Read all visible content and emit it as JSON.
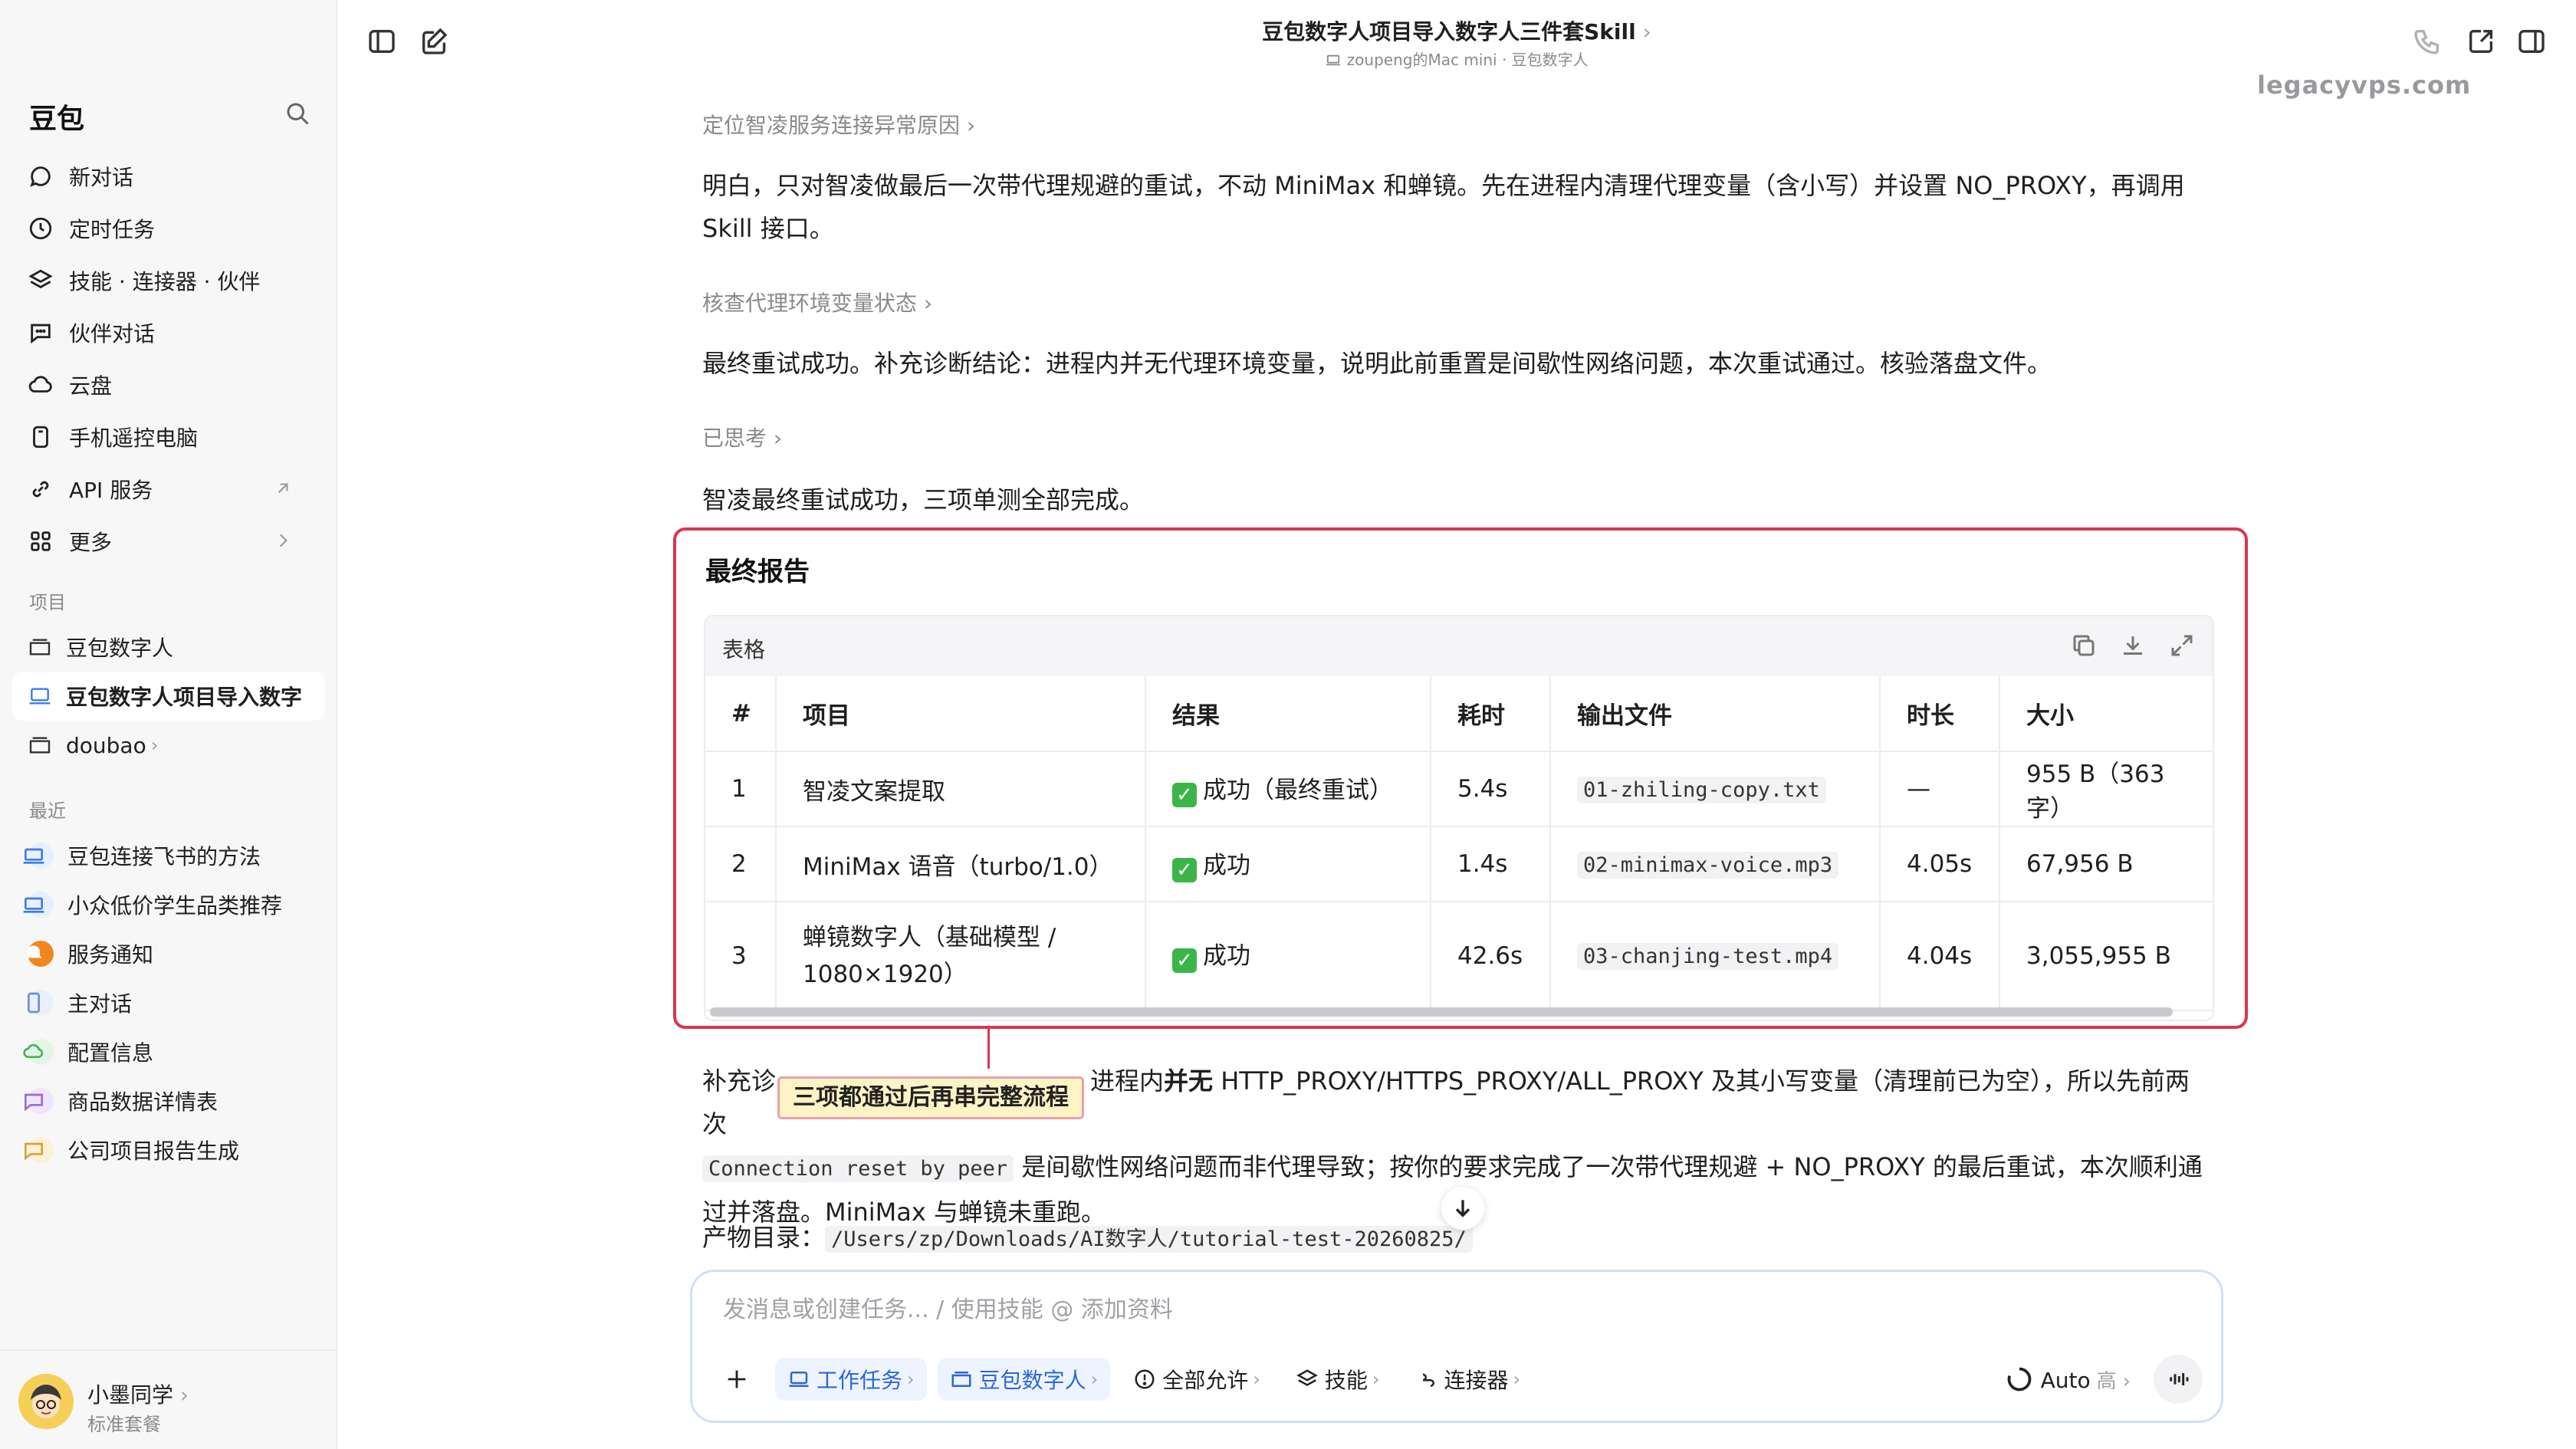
{
  "header": {
    "title": "豆包数字人项目导入数字人三件套Skill",
    "subtitle_device": "zoupeng的Mac mini",
    "subtitle_project": "豆包数字人"
  },
  "watermark": "legacyvps.com",
  "sidebar": {
    "brand": "豆包",
    "nav": [
      {
        "label": "新对话",
        "icon": "chat-bubble-icon"
      },
      {
        "label": "定时任务",
        "icon": "clock-icon"
      },
      {
        "label": "技能 · 连接器 · 伙伴",
        "icon": "layers-icon"
      },
      {
        "label": "伙伴对话",
        "icon": "chat-dots-icon"
      },
      {
        "label": "云盘",
        "icon": "cloud-icon"
      },
      {
        "label": "手机遥控电脑",
        "icon": "phone-icon"
      },
      {
        "label": "API 服务",
        "icon": "link-icon"
      },
      {
        "label": "更多",
        "icon": "grid-icon"
      }
    ],
    "projects_title": "项目",
    "projects": [
      {
        "label": "豆包数字人"
      },
      {
        "label": "豆包数字人项目导入数字"
      },
      {
        "label": "doubao"
      }
    ],
    "recent_title": "最近",
    "recent": [
      {
        "label": "豆包连接飞书的方法"
      },
      {
        "label": "小众低价学生品类推荐"
      },
      {
        "label": "服务通知"
      },
      {
        "label": "主对话"
      },
      {
        "label": "配置信息"
      },
      {
        "label": "商品数据详情表"
      },
      {
        "label": "公司项目报告生成"
      }
    ],
    "user": {
      "name": "小墨同学",
      "plan": "标准套餐"
    }
  },
  "conversation": {
    "step1": "定位智凌服务连接异常原因",
    "para1_line1": "明白，只对智凌做最后一次带代理规避的重试，不动 MiniMax 和蝉镜。先在进程内清理代理变量（含小写）并设置 NO_PROXY，再调用",
    "para1_line2": "Skill 接口。",
    "step2": "核查代理环境变量状态",
    "para2": "最终重试成功。补充诊断结论：进程内并无代理环境变量，说明此前重置是间歇性网络问题，本次重试通过。核验落盘文件。",
    "step3": "已思考",
    "para3": "智凌最终重试成功，三项单测全部完成。",
    "report_title": "最终报告",
    "table_label": "表格",
    "table_headers": [
      "#",
      "项目",
      "结果",
      "耗时",
      "输出文件",
      "时长",
      "大小"
    ],
    "table_rows": [
      {
        "n": "1",
        "item": "智凌文案提取",
        "item2": "",
        "result": "成功（最终重试）",
        "time": "5.4s",
        "file": "01-zhiling-copy.txt",
        "duration": "—",
        "size": "955 B（363 字）"
      },
      {
        "n": "2",
        "item": "MiniMax 语音（turbo/1.0）",
        "item2": "",
        "result": "成功",
        "time": "1.4s",
        "file": "02-minimax-voice.mp3",
        "duration": "4.05s",
        "size": "67,956 B"
      },
      {
        "n": "3",
        "item": "蝉镜数字人（基础模型 /",
        "item2": "1080×1920）",
        "result": "成功",
        "time": "42.6s",
        "file": "03-chanjing-test.mp4",
        "duration": "4.04s",
        "size": "3,055,955 B"
      }
    ],
    "callout": "三项都通过后再串完整流程",
    "para4_a": "补充诊",
    "para4_b": "进程内",
    "para4_bold": "并无",
    "para4_c": " HTTP_PROXY/HTTPS_PROXY/ALL_PROXY 及其小写变量（清理前已为空），所以先前两次",
    "para4_code": "Connection reset by peer",
    "para4_d": " 是间歇性网络问题而非代理导致；按你的要求完成了一次带代理规避 + NO_PROXY 的最后重试，本次顺利通",
    "para4_e": "过并落盘。MiniMax 与蝉镜未重跑。",
    "para5_label": "产物目录：",
    "para5_path": "/Users/zp/Downloads/AI数字人/tutorial-test-20260825/"
  },
  "composer": {
    "placeholder": "发消息或创建任务... / 使用技能 @ 添加资料",
    "chips": {
      "work": "工作任务",
      "project": "豆包数字人",
      "permission": "全部允许",
      "skills": "技能",
      "connectors": "连接器"
    },
    "model": "Auto",
    "model_level": "高"
  }
}
